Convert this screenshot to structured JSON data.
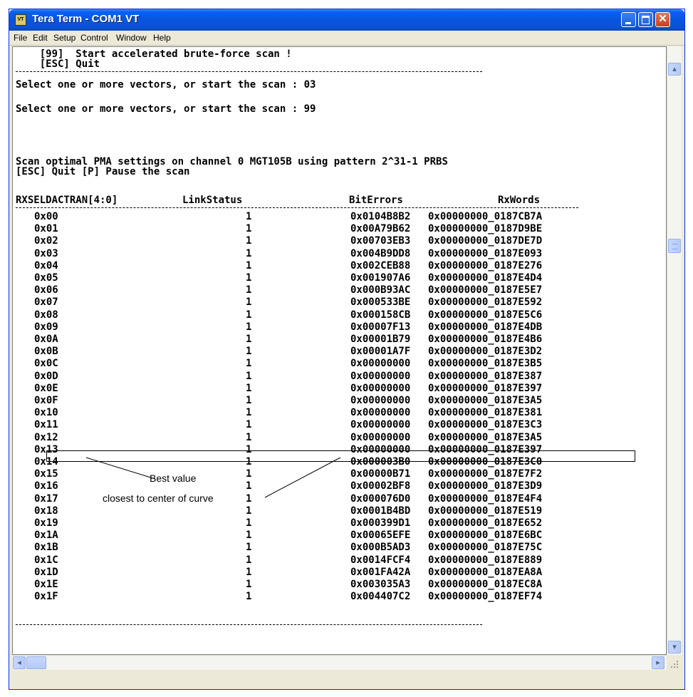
{
  "window": {
    "title": "Tera Term - COM1 VT",
    "app_icon": "VT"
  },
  "menu": [
    "File",
    "Edit",
    "Setup",
    "Control",
    "Window",
    "Help"
  ],
  "terminal": {
    "menu_lines": [
      "    [99]  Start accelerated brute-force scan !",
      "    [ESC] Quit"
    ],
    "prompt_1": "Select one or more vectors, or start the scan : 03",
    "prompt_2": "Select one or more vectors, or start the scan : 99",
    "scan_line": "Scan optimal PMA settings on channel 0 MGT105B using pattern 2^31-1 PRBS",
    "keys_line": "[ESC] Quit [P] Pause the scan",
    "headers": [
      "RXSELDACTRAN[4:0]",
      "LinkStatus",
      "BitErrors",
      "RxWords"
    ],
    "rows": [
      [
        "0x00",
        "1",
        "0x0104B8B2",
        "0x00000000_0187CB7A"
      ],
      [
        "0x01",
        "1",
        "0x00A79B62",
        "0x00000000_0187D9BE"
      ],
      [
        "0x02",
        "1",
        "0x00703EB3",
        "0x00000000_0187DE7D"
      ],
      [
        "0x03",
        "1",
        "0x004B9DD8",
        "0x00000000_0187E093"
      ],
      [
        "0x04",
        "1",
        "0x002CEB88",
        "0x00000000_0187E276"
      ],
      [
        "0x05",
        "1",
        "0x001907A6",
        "0x00000000_0187E4D4"
      ],
      [
        "0x06",
        "1",
        "0x000B93AC",
        "0x00000000_0187E5E7"
      ],
      [
        "0x07",
        "1",
        "0x000533BE",
        "0x00000000_0187E592"
      ],
      [
        "0x08",
        "1",
        "0x000158CB",
        "0x00000000_0187E5C6"
      ],
      [
        "0x09",
        "1",
        "0x00007F13",
        "0x00000000_0187E4DB"
      ],
      [
        "0x0A",
        "1",
        "0x00001B79",
        "0x00000000_0187E4B6"
      ],
      [
        "0x0B",
        "1",
        "0x00001A7F",
        "0x00000000_0187E3D2"
      ],
      [
        "0x0C",
        "1",
        "0x00000000",
        "0x00000000_0187E3B5"
      ],
      [
        "0x0D",
        "1",
        "0x00000000",
        "0x00000000_0187E387"
      ],
      [
        "0x0E",
        "1",
        "0x00000000",
        "0x00000000_0187E397"
      ],
      [
        "0x0F",
        "1",
        "0x00000000",
        "0x00000000_0187E3A5"
      ],
      [
        "0x10",
        "1",
        "0x00000000",
        "0x00000000_0187E381"
      ],
      [
        "0x11",
        "1",
        "0x00000000",
        "0x00000000_0187E3C3"
      ],
      [
        "0x12",
        "1",
        "0x00000000",
        "0x00000000_0187E3A5"
      ],
      [
        "0x13",
        "1",
        "0x00000000",
        "0x00000000_0187E397"
      ],
      [
        "0x14",
        "1",
        "0x000003B0",
        "0x00000000_0187E3C0"
      ],
      [
        "0x15",
        "1",
        "0x00000B71",
        "0x00000000_0187E7F2"
      ],
      [
        "0x16",
        "1",
        "0x00002BF8",
        "0x00000000_0187E3D9"
      ],
      [
        "0x17",
        "1",
        "0x000076D0",
        "0x00000000_0187E4F4"
      ],
      [
        "0x18",
        "1",
        "0x0001B4BD",
        "0x00000000_0187E519"
      ],
      [
        "0x19",
        "1",
        "0x000399D1",
        "0x00000000_0187E652"
      ],
      [
        "0x1A",
        "1",
        "0x00065EFE",
        "0x00000000_0187E6BC"
      ],
      [
        "0x1B",
        "1",
        "0x000B5AD3",
        "0x00000000_0187E75C"
      ],
      [
        "0x1C",
        "1",
        "0x0014FCF4",
        "0x00000000_0187E889"
      ],
      [
        "0x1D",
        "1",
        "0x001FA42A",
        "0x00000000_0187EA8A"
      ],
      [
        "0x1E",
        "1",
        "0x003035A3",
        "0x00000000_0187EC8A"
      ],
      [
        "0x1F",
        "1",
        "0x004407C2",
        "0x00000000_0187EF74"
      ]
    ]
  },
  "callout": {
    "line1": "Best value",
    "line2": "closest to center of curve"
  },
  "icons": {
    "minimize": "minimize-icon",
    "maximize": "maximize-icon",
    "close": "close-icon",
    "scroll_up": "arrow-up-icon",
    "scroll_down": "arrow-down-icon",
    "scroll_left": "arrow-left-icon",
    "scroll_right": "arrow-right-icon"
  }
}
